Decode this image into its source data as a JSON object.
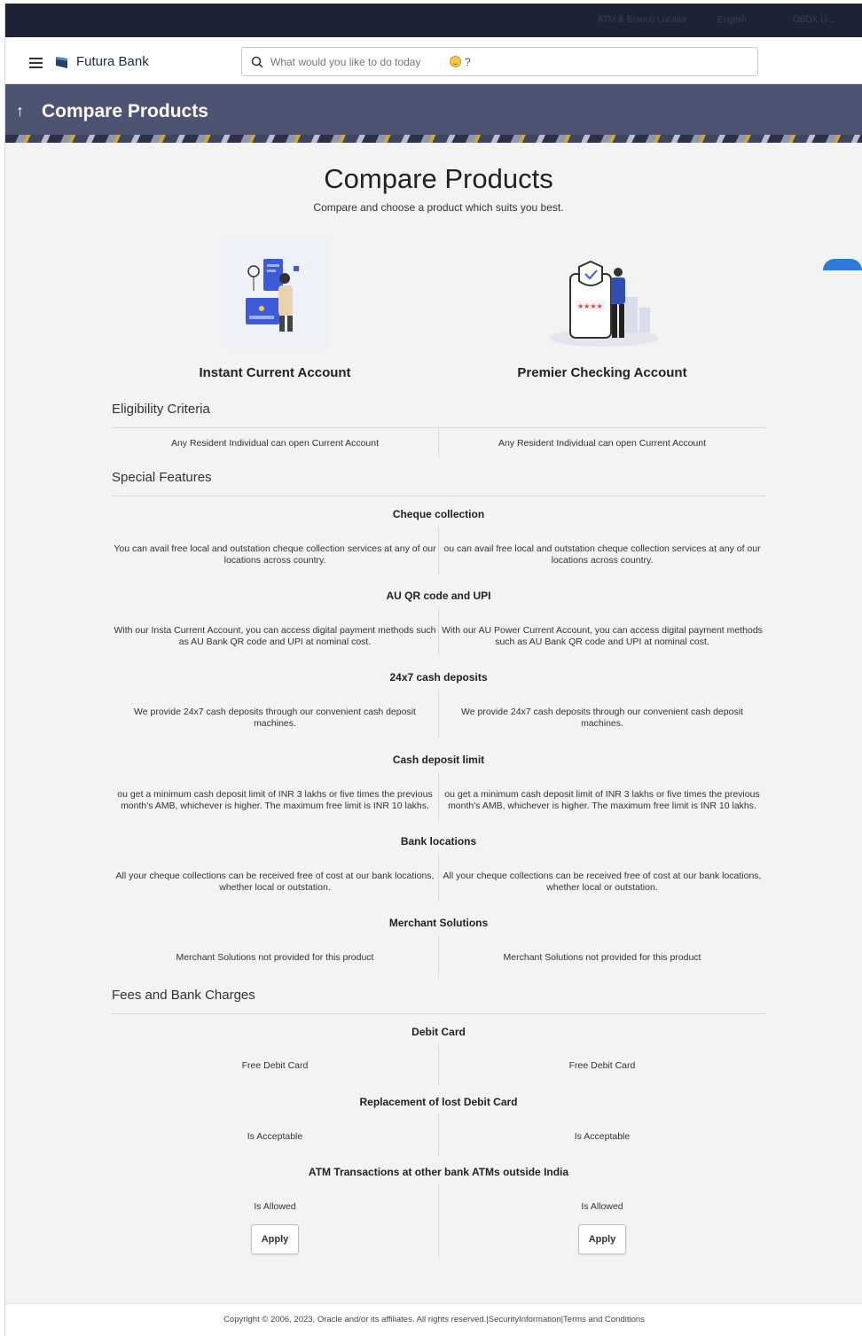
{
  "topbar": {
    "items": [
      "ATM & Branch Locator",
      "English",
      "OBDX U..."
    ]
  },
  "header": {
    "bank_name": "Futura Bank",
    "search_placeholder": "What would you like to do today",
    "search_suffix": "?"
  },
  "banner": {
    "title": "Compare Products"
  },
  "main": {
    "heading": "Compare Products",
    "subheading": "Compare and choose a product which suits you best.",
    "products": [
      {
        "name": "Instant Current Account"
      },
      {
        "name": "Premier Checking Account"
      }
    ],
    "sections": {
      "eligibility": "Eligibility Criteria",
      "features": "Special Features",
      "fees": "Fees and Bank Charges"
    },
    "eligibility": {
      "left": "Any Resident Individual can open Current Account",
      "right": "Any Resident Individual can open Current Account"
    },
    "features": [
      {
        "title": "Cheque collection",
        "left": [
          "You can avail free local and outstation cheque collection services at any of our",
          "locations across country."
        ],
        "right": [
          "ou can avail free local and outstation cheque collection services at any of our",
          "locations across country."
        ]
      },
      {
        "title": "AU QR code and UPI",
        "left": [
          "With our Insta Current Account, you can access digital payment methods such",
          "as AU Bank QR code and UPI at nominal cost."
        ],
        "right": [
          "With our AU Power Current Account, you can access digital payment methods",
          "such as AU Bank QR code and UPI at nominal cost."
        ]
      },
      {
        "title": "24x7 cash deposits",
        "left": [
          "We provide 24x7 cash deposits through our convenient cash deposit",
          "machines."
        ],
        "right": [
          "We provide 24x7 cash deposits through our convenient cash deposit",
          "machines."
        ]
      },
      {
        "title": "Cash deposit limit",
        "left": [
          "ou get a minimum cash deposit limit of INR 3 lakhs or five times the previous",
          "month's AMB, whichever is higher. The maximum free limit is INR 10 lakhs."
        ],
        "right": [
          "ou get a minimum cash deposit limit of INR 3 lakhs or five times the previous",
          "month's AMB, whichever is higher. The maximum free limit is INR 10 lakhs."
        ]
      },
      {
        "title": "Bank locations",
        "left": [
          "All your cheque collections can be received free of cost at our bank locations,",
          "whether local or outstation."
        ],
        "right": [
          "All your cheque collections can be received free of cost at our bank locations,",
          "whether local or outstation."
        ]
      },
      {
        "title": "Merchant Solutions",
        "left": [
          "Merchant Solutions not provided for this product"
        ],
        "right": [
          "Merchant Solutions not provided for this product"
        ]
      }
    ],
    "fees": [
      {
        "title": "Debit Card",
        "left": "Free Debit Card",
        "right": "Free Debit Card"
      },
      {
        "title": "Replacement of lost Debit Card",
        "left": "Is Acceptable",
        "right": "Is Acceptable"
      },
      {
        "title": "ATM Transactions at other bank ATMs outside India",
        "left": "Is Allowed",
        "right": "Is Allowed"
      }
    ],
    "apply_label": "Apply"
  },
  "footer": {
    "copyright": "Copyright © 2006, 2023, Oracle and/or its affiliates. All rights reserved.",
    "security_link": "SecurityInformation",
    "terms_link": "Terms and Conditions",
    "separator": "|"
  }
}
